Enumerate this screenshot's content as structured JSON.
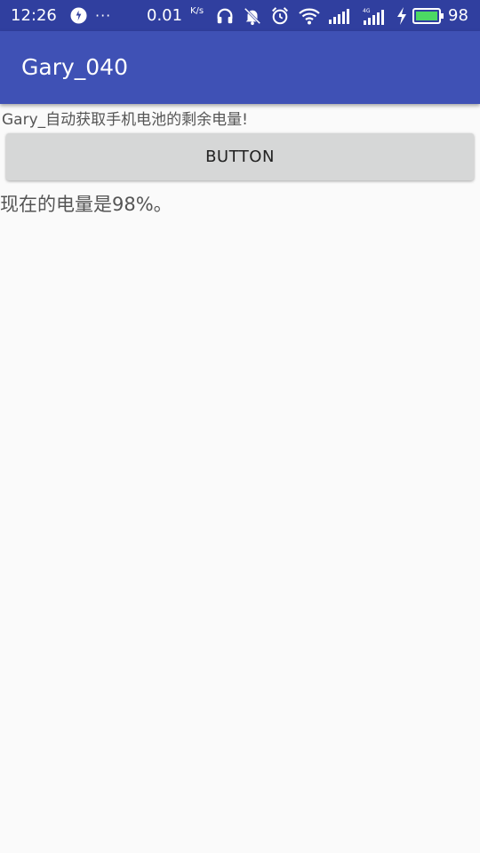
{
  "status_bar": {
    "time": "12:26",
    "more_indicator": "···",
    "net_speed": "0.01",
    "net_speed_unit": "K/s",
    "battery_level": "98",
    "colors": {
      "background": "#303f9f",
      "battery_fill": "#4cd964"
    },
    "icons": [
      "sync-icon",
      "headphones-icon",
      "notifications-off-icon",
      "alarm-icon",
      "wifi-icon",
      "cell-signal-icon",
      "cell-signal-4g-icon",
      "charging-icon",
      "battery-icon"
    ]
  },
  "app_bar": {
    "title": "Gary_040",
    "color": "#3f51b5"
  },
  "content": {
    "description": "Gary_自动获取手机电池的剩余电量!",
    "button_label": "BUTTON",
    "result": "现在的电量是98%。"
  }
}
